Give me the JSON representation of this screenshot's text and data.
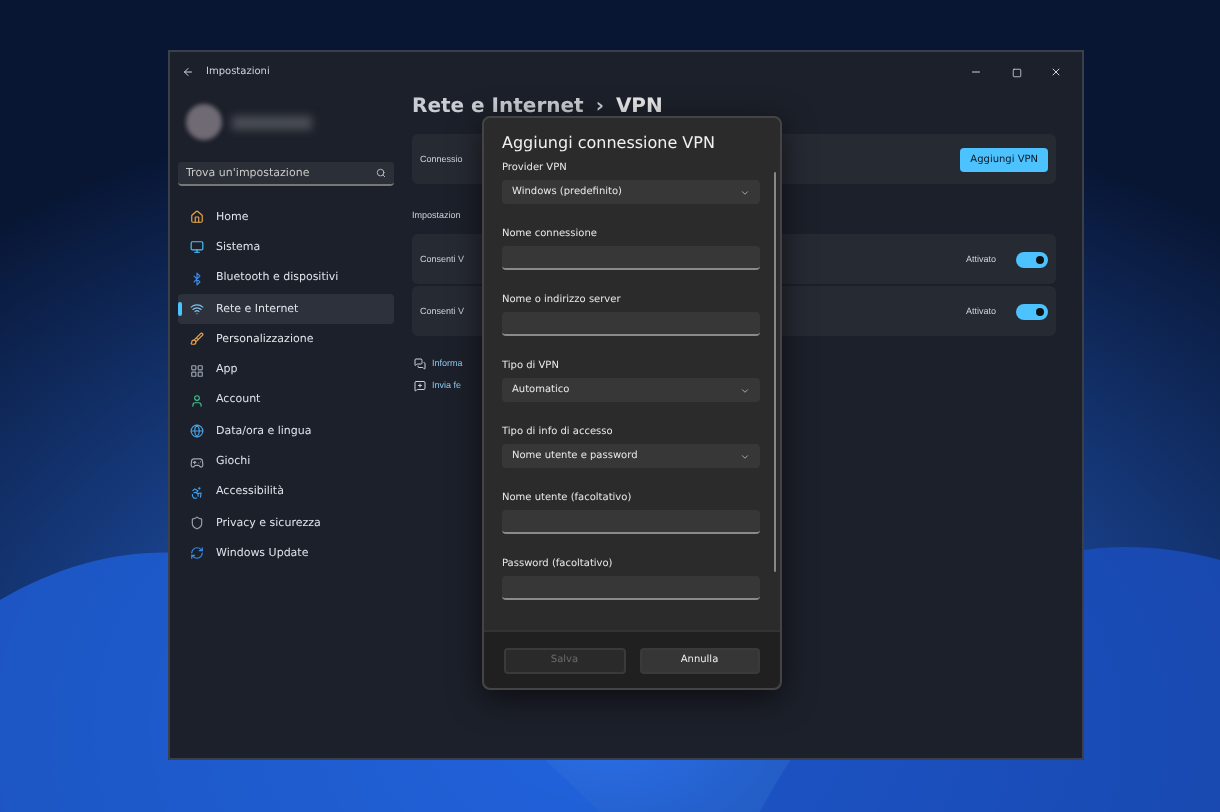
{
  "window": {
    "title": "Impostazioni"
  },
  "sidebar": {
    "search_placeholder": "Trova un'impostazione",
    "items": [
      {
        "label": "Home",
        "selected": false
      },
      {
        "label": "Sistema",
        "selected": false
      },
      {
        "label": "Bluetooth e dispositivi",
        "selected": false
      },
      {
        "label": "Rete e Internet",
        "selected": true
      },
      {
        "label": "Personalizzazione",
        "selected": false
      },
      {
        "label": "App",
        "selected": false
      },
      {
        "label": "Account",
        "selected": false
      },
      {
        "label": "Data/ora e lingua",
        "selected": false
      },
      {
        "label": "Giochi",
        "selected": false
      },
      {
        "label": "Accessibilità",
        "selected": false
      },
      {
        "label": "Privacy e sicurezza",
        "selected": false
      },
      {
        "label": "Windows Update",
        "selected": false
      }
    ]
  },
  "breadcrumb": {
    "parent": "Rete e Internet",
    "separator": "›",
    "current": "VPN"
  },
  "connections_card": {
    "label": "Connessio",
    "button": "Aggiungi VPN"
  },
  "section_label": "Impostazion",
  "toggle_rows": [
    {
      "label": "Consenti V",
      "state_text": "Attivato",
      "on": true
    },
    {
      "label": "Consenti V",
      "state_text": "Attivato",
      "on": true
    }
  ],
  "links": [
    "Informa",
    "Invia fe"
  ],
  "dialog": {
    "title": "Aggiungi connessione VPN",
    "fields": [
      {
        "label": "Provider VPN",
        "kind": "select",
        "value": "Windows (predefinito)"
      },
      {
        "label": "Nome connessione",
        "kind": "input"
      },
      {
        "label": "Nome o indirizzo server",
        "kind": "input"
      },
      {
        "label": "Tipo di VPN",
        "kind": "select",
        "value": "Automatico"
      },
      {
        "label": "Tipo di info di accesso",
        "kind": "select",
        "value": "Nome utente e password"
      },
      {
        "label": "Nome utente (facoltativo)",
        "kind": "input"
      },
      {
        "label": "Password (facoltativo)",
        "kind": "input"
      }
    ],
    "buttons": [
      {
        "label": "Salva",
        "disabled": true
      },
      {
        "label": "Annulla",
        "disabled": false
      }
    ]
  }
}
